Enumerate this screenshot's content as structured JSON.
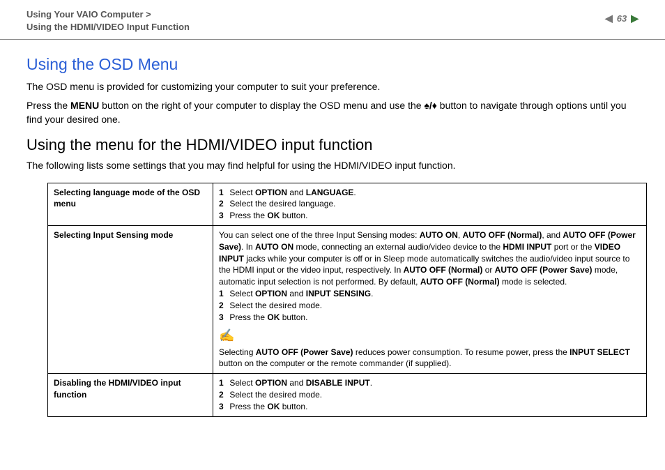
{
  "header": {
    "breadcrumb_line1": "Using Your VAIO Computer >",
    "breadcrumb_line2": "Using the HDMI/VIDEO Input Function",
    "page_number": "63"
  },
  "main": {
    "title1": "Using the OSD Menu",
    "para1": "The OSD menu is provided for customizing your computer to suit your preference.",
    "para2_a": "Press the ",
    "para2_b_bold": "MENU",
    "para2_c": " button on the right of your computer to display the OSD menu and use the ",
    "para2_d": " button to navigate through options until you find your desired one.",
    "title2": "Using the menu for the HDMI/VIDEO input function",
    "para3": "The following lists some settings that you may find helpful for using the HDMI/VIDEO input function."
  },
  "table": {
    "row1": {
      "label": "Selecting language mode of the OSD menu",
      "s1a": "Select ",
      "s1b": "OPTION",
      "s1c": " and ",
      "s1d": "LANGUAGE",
      "s1e": ".",
      "s2": "Select the desired language.",
      "s3a": "Press the ",
      "s3b": "OK",
      "s3c": " button."
    },
    "row2": {
      "label": "Selecting Input Sensing mode",
      "intro_a": "You can select one of the three Input Sensing modes: ",
      "intro_b": "AUTO ON",
      "intro_c": ", ",
      "intro_d": "AUTO OFF (Normal)",
      "intro_e": ", and ",
      "intro_f": "AUTO OFF (Power Save)",
      "intro_g": ". In ",
      "intro_h": "AUTO ON",
      "intro_i": " mode, connecting an external audio/video device to the ",
      "intro_j": "HDMI INPUT",
      "intro_k": " port or the ",
      "intro_l": "VIDEO INPUT",
      "intro_m": " jacks while your computer is off or in Sleep mode automatically switches the audio/video input source to the HDMI input or the video input, respectively. In ",
      "intro_n": "AUTO OFF (Normal)",
      "intro_o": " or ",
      "intro_p": "AUTO OFF (Power Save)",
      "intro_q": " mode, automatic input selection is not performed. By default, ",
      "intro_r": "AUTO OFF (Normal)",
      "intro_s": " mode is selected.",
      "s1a": "Select ",
      "s1b": "OPTION",
      "s1c": " and ",
      "s1d": "INPUT SENSING",
      "s1e": ".",
      "s2": "Select the desired mode.",
      "s3a": "Press the ",
      "s3b": "OK",
      "s3c": " button.",
      "note_a": "Selecting ",
      "note_b": "AUTO OFF (Power Save)",
      "note_c": " reduces power consumption. To resume power, press the ",
      "note_d": "INPUT SELECT",
      "note_e": " button on the computer or the remote commander (if supplied)."
    },
    "row3": {
      "label": "Disabling the HDMI/VIDEO input function",
      "s1a": "Select ",
      "s1b": "OPTION",
      "s1c": " and ",
      "s1d": "DISABLE INPUT",
      "s1e": ".",
      "s2": "Select the desired mode.",
      "s3a": "Press the ",
      "s3b": "OK",
      "s3c": " button."
    }
  }
}
